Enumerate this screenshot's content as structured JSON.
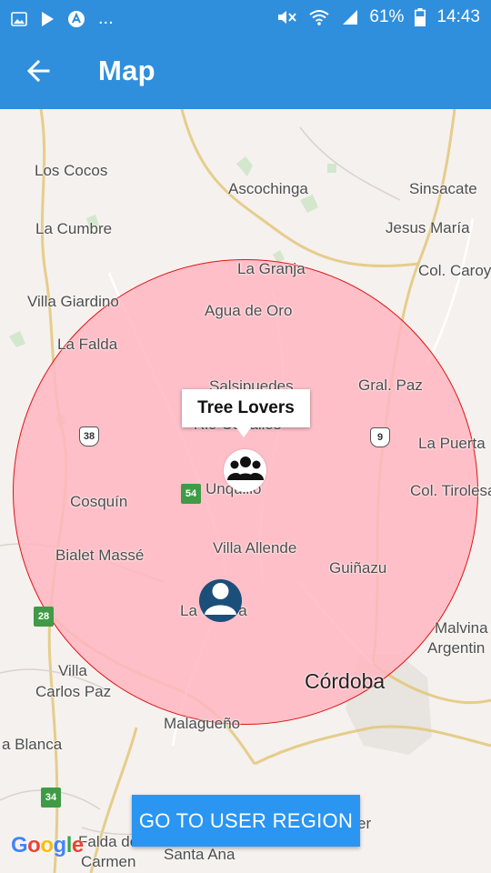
{
  "status_bar": {
    "battery": "61%",
    "time": "14:43",
    "ellipsis": "...",
    "icons": [
      "image-icon",
      "play-icon",
      "app-logo-icon",
      "mute-icon",
      "wifi-icon",
      "signal-icon",
      "battery-icon"
    ]
  },
  "app_bar": {
    "title": "Map",
    "back_icon": "arrow-left-icon"
  },
  "map": {
    "places": {
      "los_cocos": "Los Cocos",
      "ascochinga": "Ascochinga",
      "sinsacate": "Sinsacate",
      "la_cumbre": "La Cumbre",
      "jesus_maria": "Jesus María",
      "la_granja": "La Granja",
      "col_caroya": "Col. Caroy",
      "villa_giardino": "Villa Giardino",
      "agua_de_oro": "Agua de Oro",
      "la_falda": "La Falda",
      "salsipuedes": "Salsipuedes",
      "gral_paz": "Gral. Paz",
      "rio_ceballos": "Rio Ceballos",
      "la_puerta": "La Puerta",
      "unquillo": "Unquillo",
      "cosquin": "Cosquín",
      "col_tirolesa": "Col. Tirolesa",
      "bialet_masse": "Bialet Massé",
      "villa_allende": "Villa Allende",
      "guinazu": "Guiñazu",
      "la_calera": "La Calera",
      "malvinas": "Malvina",
      "argentina": "Argentin",
      "villa": "Villa",
      "carlos_paz": "Carlos Paz",
      "cordoba": "Córdoba",
      "malagueno": "Malagueño",
      "la_blanca": "a Blanca",
      "falda_de": "Falda de",
      "carmen": "Carmen",
      "santa_ana": "Santa Ana",
      "er": "er"
    },
    "routes": {
      "r38": "38",
      "r9": "9",
      "r54": "54",
      "r28": "28",
      "r34": "34"
    },
    "region_circle_color": "#FFB6C1",
    "region_border_color": "#E01414"
  },
  "group_marker": {
    "name": "Tree Lovers",
    "icon": "group-icon"
  },
  "user_marker": {
    "icon": "user-avatar-icon"
  },
  "go_button": {
    "label": "GO TO USER REGION"
  },
  "google_logo": {
    "letters": [
      "G",
      "o",
      "o",
      "g",
      "l",
      "e"
    ]
  },
  "colors": {
    "app_bar": "#2F8FDC",
    "button": "#2B95F2"
  }
}
